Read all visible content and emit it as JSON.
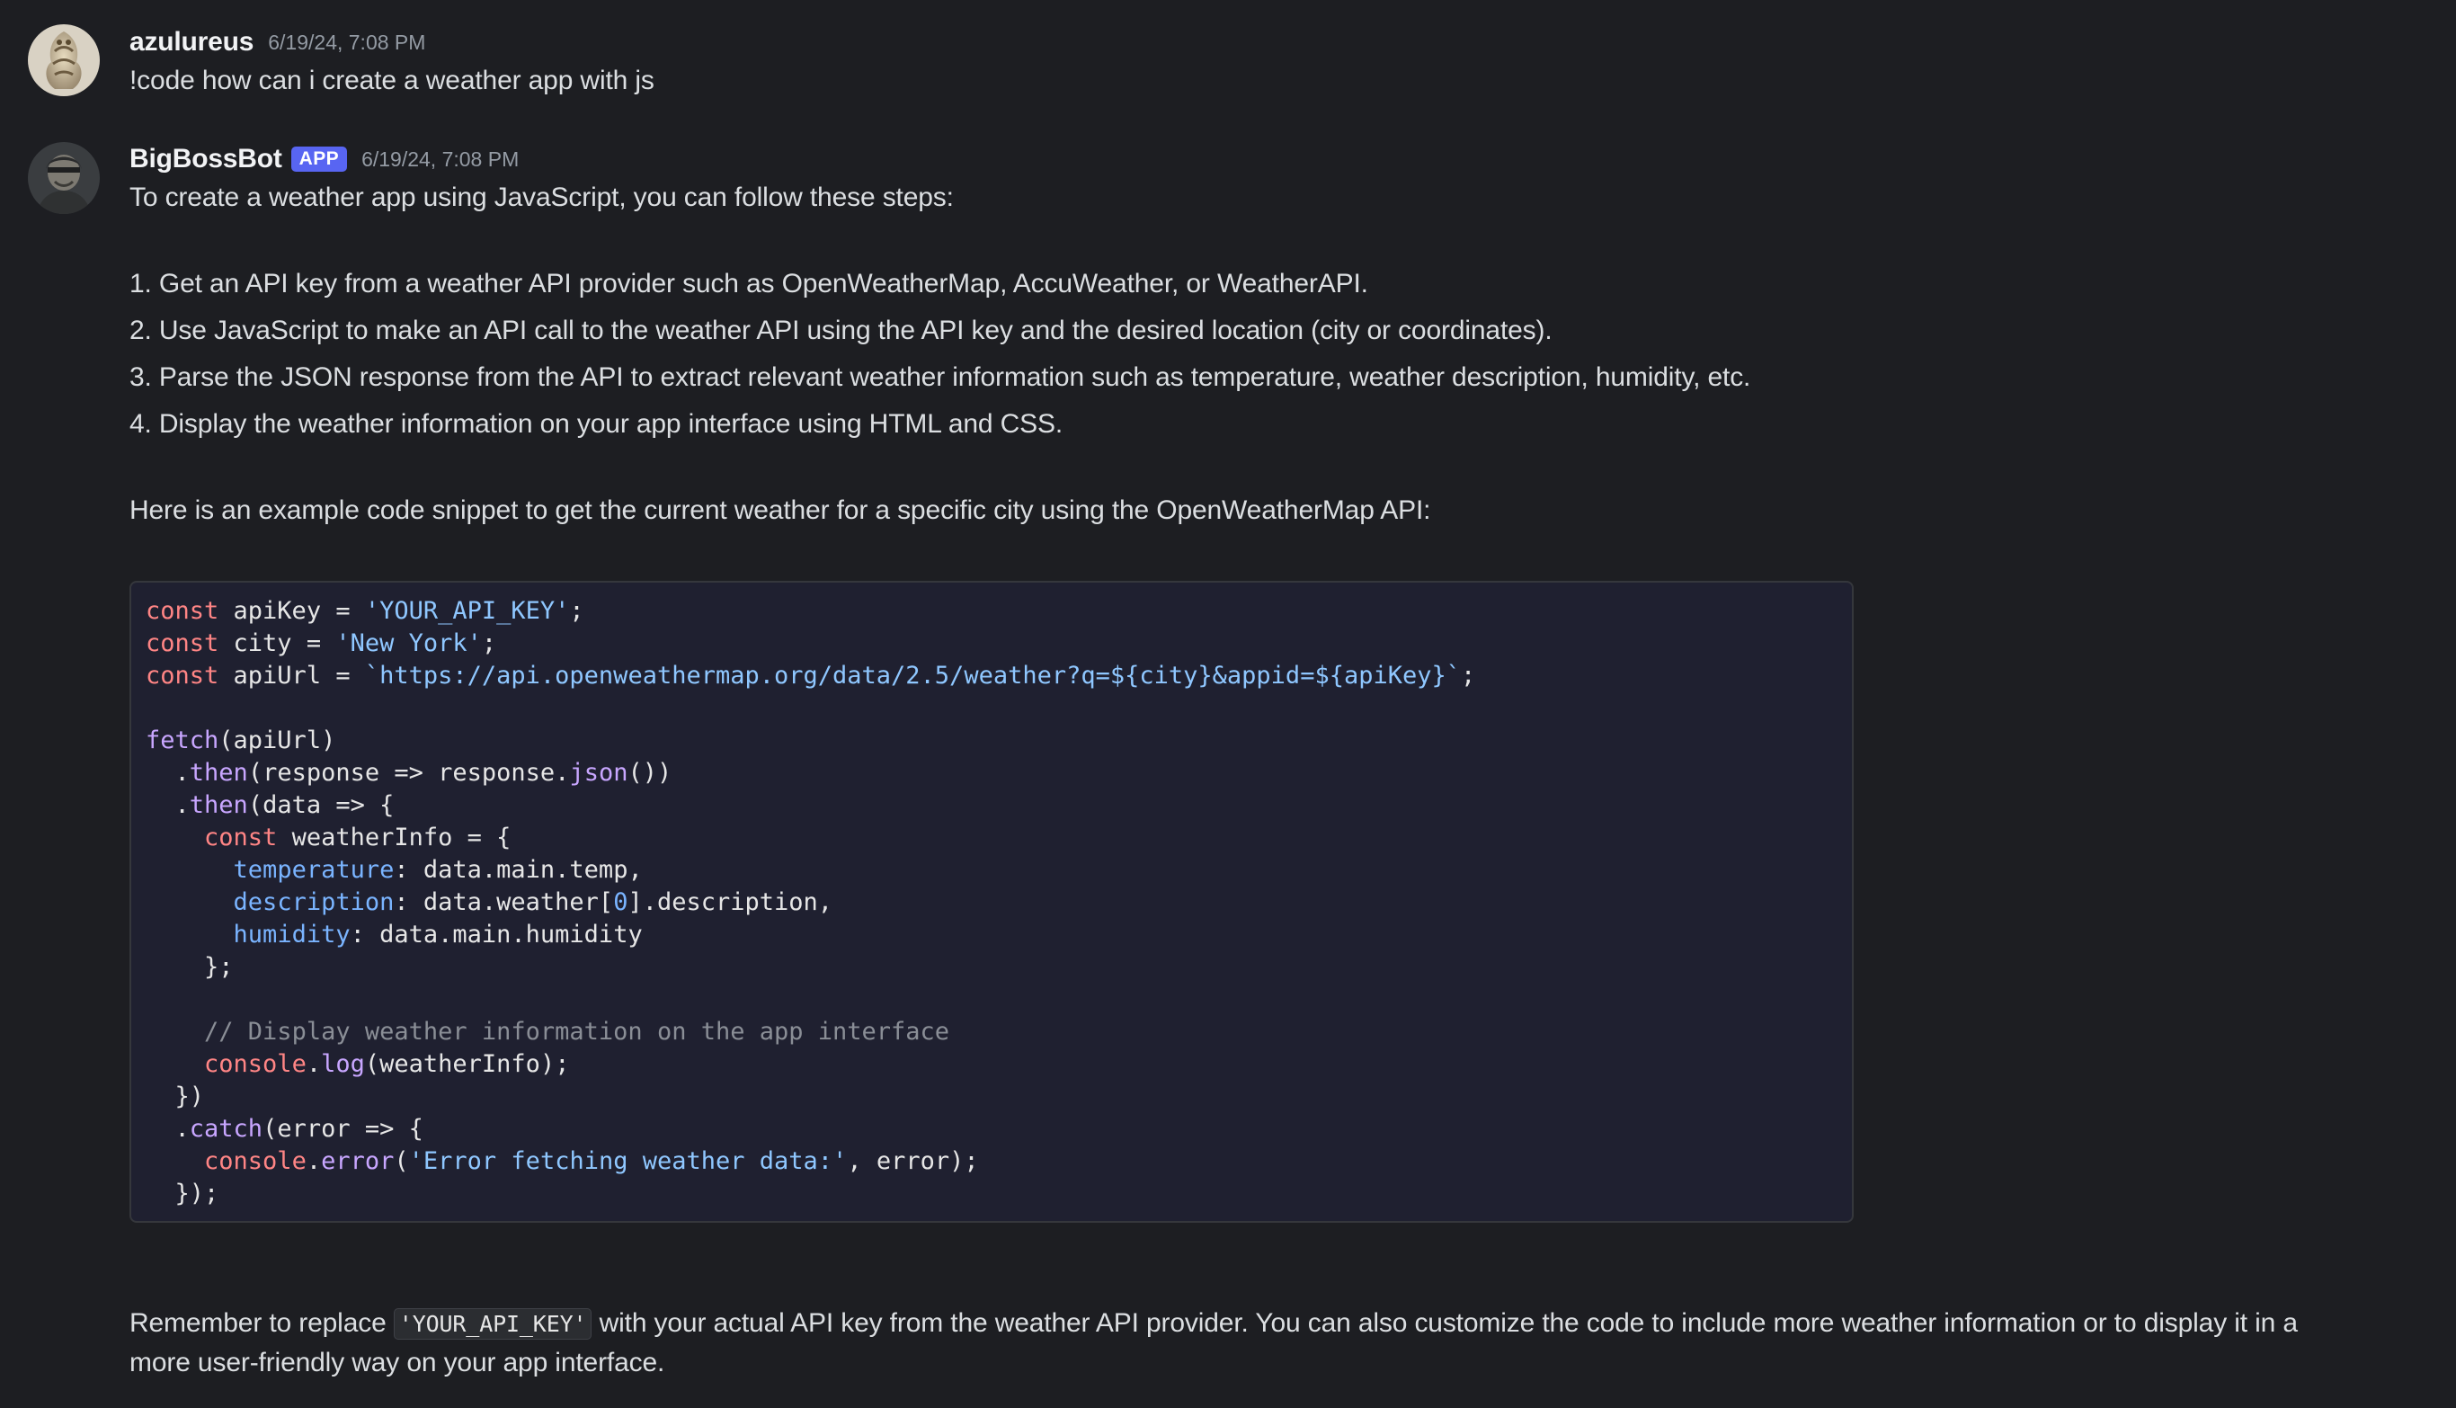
{
  "messages": {
    "user": {
      "author": "azulureus",
      "timestamp": "6/19/24, 7:08 PM",
      "text": "!code how can i create a weather app with js"
    },
    "bot": {
      "author": "BigBossBot",
      "badge": "APP",
      "timestamp": "6/19/24, 7:08 PM",
      "intro": "To create a weather app using JavaScript, you can follow these steps:",
      "steps": [
        "1. Get an API key from a weather API provider such as OpenWeatherMap, AccuWeather, or WeatherAPI.",
        "2. Use JavaScript to make an API call to the weather API using the API key and the desired location (city or coordinates).",
        "3. Parse the JSON response from the API to extract relevant weather information such as temperature, weather description, humidity, etc.",
        "4. Display the weather information on your app interface using HTML and CSS."
      ],
      "snippet_intro": "Here is an example code snippet to get the current weather for a specific city using the OpenWeatherMap API:",
      "code_lines": [
        "const apiKey = 'YOUR_API_KEY';",
        "const city = 'New York';",
        "const apiUrl = `https://api.openweathermap.org/data/2.5/weather?q=${city}&appid=${apiKey}`;",
        "",
        "fetch(apiUrl)",
        "  .then(response => response.json())",
        "  .then(data => {",
        "    const weatherInfo = {",
        "      temperature: data.main.temp,",
        "      description: data.weather[0].description,",
        "      humidity: data.main.humidity",
        "    };",
        "",
        "    // Display weather information on the app interface",
        "    console.log(weatherInfo);",
        "  })",
        "  .catch(error => {",
        "    console.error('Error fetching weather data:', error);",
        "  });"
      ],
      "outro_before_code": "Remember to replace ",
      "outro_inline_code": "'YOUR_API_KEY'",
      "outro_after_code": " with your actual API key from the weather API provider. You can also customize the code to include more weather information or to display it in a",
      "outro_line2": "more user-friendly way on your app interface."
    }
  },
  "colors": {
    "background": "#1d1e22",
    "code_background": "#1f2030",
    "badge": "#5865f2",
    "keyword": "#ff8585",
    "string": "#8fc7ff",
    "function": "#c8a6ff"
  },
  "icons": {
    "user_avatar": "dragon-avatar",
    "bot_avatar": "soldier-avatar"
  }
}
